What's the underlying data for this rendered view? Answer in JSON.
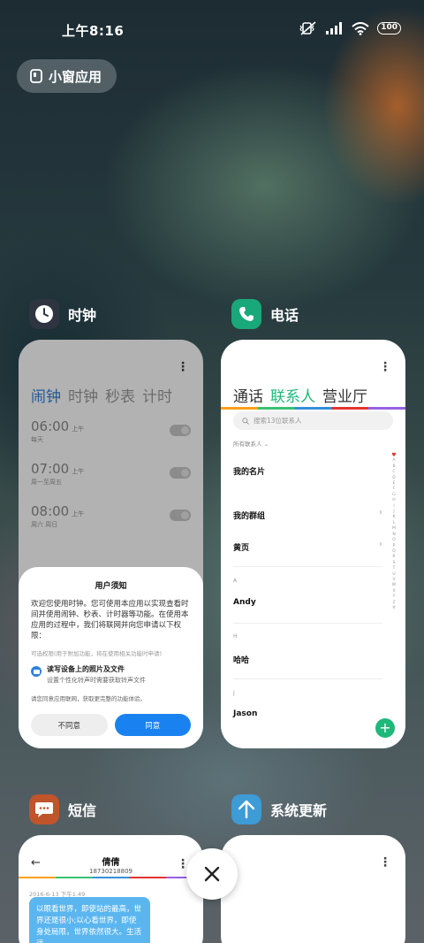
{
  "status_bar": {
    "time": "上午8:16",
    "battery": "100"
  },
  "floating_window_button": {
    "label": "小窗应用"
  },
  "apps": {
    "clock": {
      "name": "时钟",
      "tabs": [
        "闹钟",
        "时钟",
        "秒表",
        "计时"
      ],
      "active_tab": 0,
      "alarms": [
        {
          "time": "06:00",
          "ampm": "上午",
          "days": "每天"
        },
        {
          "time": "07:00",
          "ampm": "上午",
          "days": "周一至周五"
        },
        {
          "time": "08:00",
          "ampm": "上午",
          "days": "周六 周日"
        }
      ],
      "dialog": {
        "title": "用户须知",
        "body": "欢迎您使用时钟。您可使用本应用以实现查看时间并使用闹钟、秒表、计时器等功能。在使用本应用的过程中，我们将联网并向您申请以下权限：",
        "optional_note": "可选权限(用于附加功能，将在使用相关功能时申请)",
        "permission_title": "读写设备上的照片及文件",
        "permission_desc": "设置个性化铃声时需要获取铃声文件",
        "network_note": "请您同意应用联网，获取更完整的功能体验。",
        "cancel_label": "不同意",
        "ok_label": "同意"
      }
    },
    "phone": {
      "name": "电话",
      "tabs": [
        "通话",
        "联系人",
        "营业厅"
      ],
      "active_tab": 1,
      "search_placeholder": "搜索13位联系人",
      "filter_label": "所有联系人",
      "my_card": "我的名片",
      "my_groups": "我的群组",
      "yellow_pages": "黄页",
      "sections": [
        {
          "header": "A",
          "name": "Andy"
        },
        {
          "header": "H",
          "name": "哈哈"
        },
        {
          "header": "J",
          "name": "Jason"
        }
      ],
      "index_letters": [
        "A",
        "B",
        "C",
        "D",
        "E",
        "F",
        "G",
        "H",
        "I",
        "J",
        "K",
        "L",
        "M",
        "N",
        "O",
        "P",
        "Q",
        "R",
        "S",
        "T",
        "U",
        "V",
        "W",
        "X",
        "Y",
        "Z",
        "#"
      ]
    },
    "sms": {
      "name": "短信",
      "contact_name": "倩倩",
      "contact_number": "18730218809",
      "date": "2016-6-13 下午1:49",
      "message": "以眼看世界，即使站的最高，世界还是很小;以心看世界，即使身处局限，世界依然很大。生活远"
    },
    "system_update": {
      "name": "系统更新"
    }
  },
  "colors": {
    "clock_icon_bg": "#2f3540",
    "phone_icon_bg": "#19a879",
    "sms_icon_bg": "#c0542b",
    "update_icon_bg": "#3d9bd6",
    "accent_blue": "#1a82f0",
    "accent_green": "#1fb87a"
  }
}
